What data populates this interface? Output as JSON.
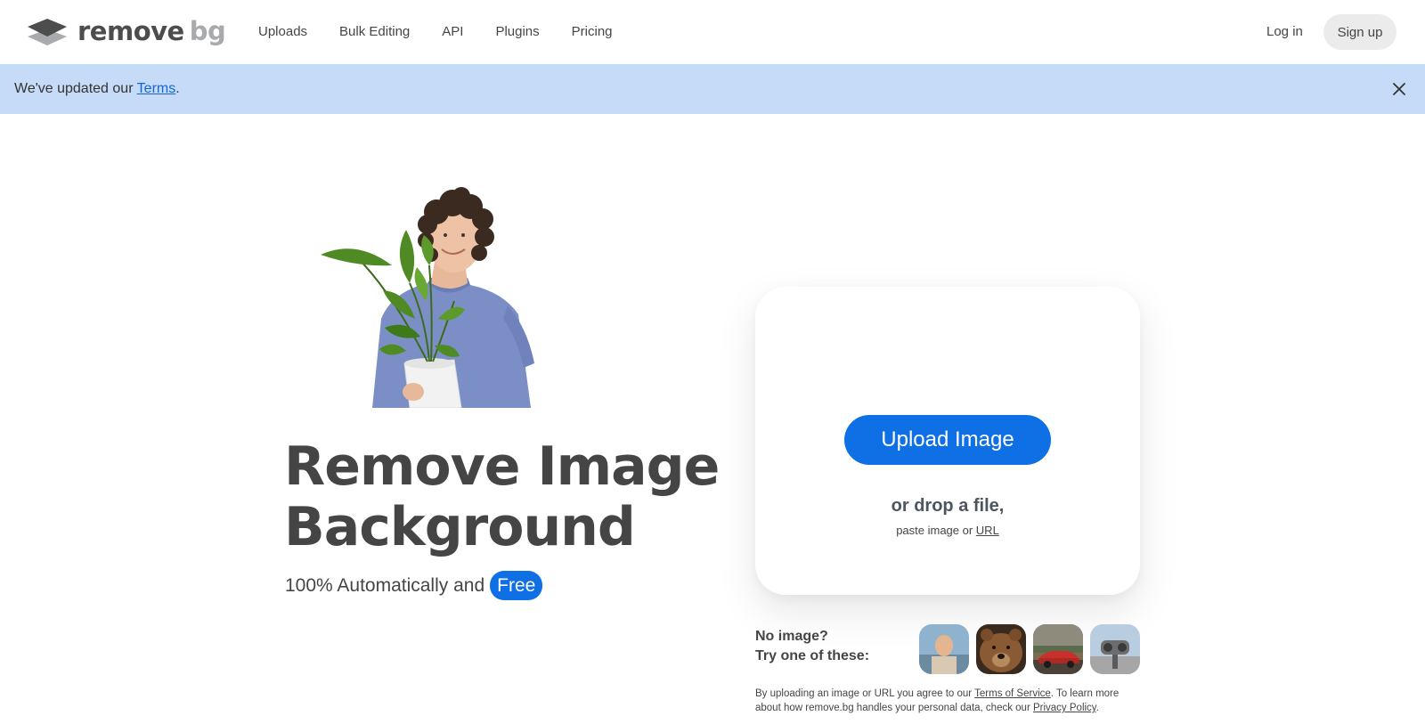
{
  "header": {
    "brand_word1": "remove",
    "brand_word2": "bg",
    "nav": [
      "Uploads",
      "Bulk Editing",
      "API",
      "Plugins",
      "Pricing"
    ],
    "login": "Log in",
    "signup": "Sign up"
  },
  "notice": {
    "text_before": "We've updated our ",
    "link": "Terms",
    "text_after": "."
  },
  "hero": {
    "headline_line1": "Remove Image",
    "headline_line2": "Background",
    "sub_text": "100% Automatically and",
    "badge": "Free"
  },
  "upload": {
    "button": "Upload Image",
    "drop_text": "or drop a file,",
    "paste_prefix": "paste image or ",
    "paste_link": "URL"
  },
  "samples": {
    "label_line1": "No image?",
    "label_line2": "Try one of these:"
  },
  "legal": {
    "part1": "By uploading an image or URL you agree to our ",
    "tos_link": "Terms of Service",
    "part2": ". To learn more about how remove.bg handles your personal data, check our ",
    "privacy_link": "Privacy Policy",
    "part3": "."
  },
  "colors": {
    "accent": "#0f70e6",
    "banner": "#c6dbf7",
    "text": "#454545"
  }
}
